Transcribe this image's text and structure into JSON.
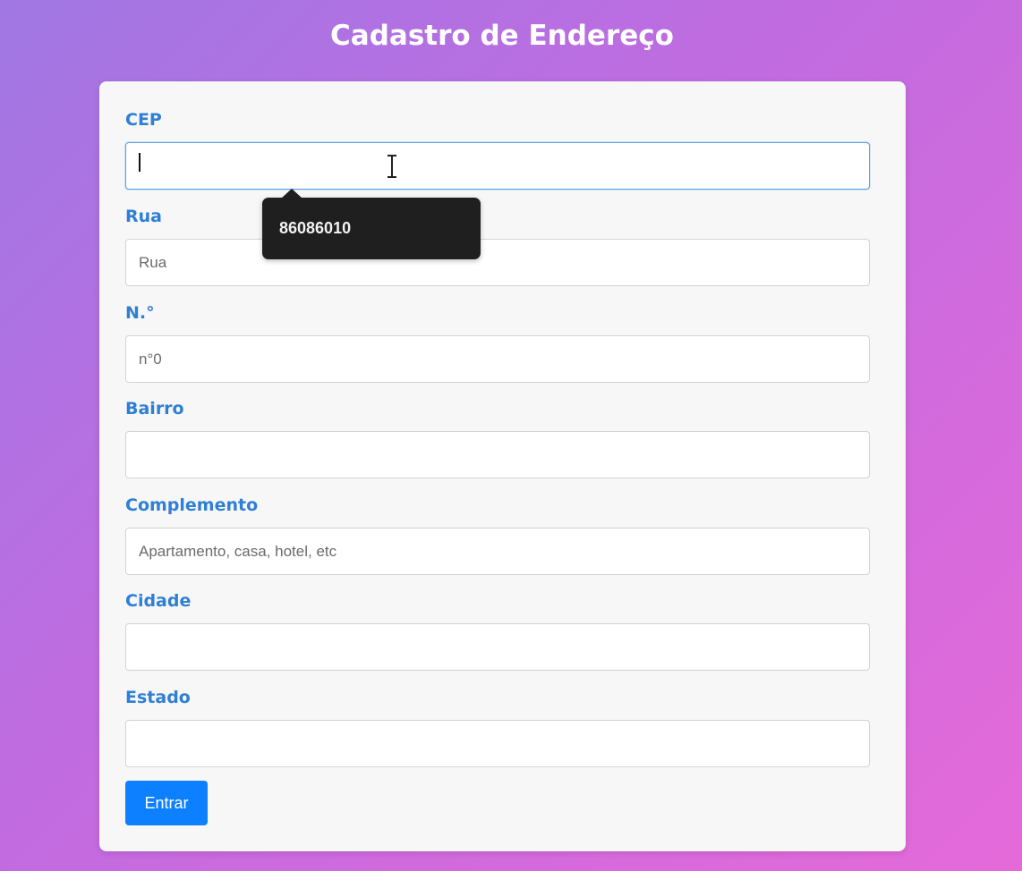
{
  "page": {
    "title": "Cadastro de Endereço"
  },
  "form": {
    "cep": {
      "label": "CEP",
      "value": "",
      "placeholder": ""
    },
    "rua": {
      "label": "Rua",
      "value": "",
      "placeholder": "Rua"
    },
    "numero": {
      "label": "N.°",
      "value": "",
      "placeholder": "n°0"
    },
    "bairro": {
      "label": "Bairro",
      "value": "",
      "placeholder": ""
    },
    "complemento": {
      "label": "Complemento",
      "value": "",
      "placeholder": "Apartamento, casa, hotel, etc"
    },
    "cidade": {
      "label": "Cidade",
      "value": "",
      "placeholder": ""
    },
    "estado": {
      "label": "Estado",
      "value": "",
      "placeholder": ""
    },
    "submit_label": "Entrar"
  },
  "autofill_suggestion": {
    "text": "86086010"
  },
  "colors": {
    "label": "#2f7fd4",
    "button": "#0d80ff",
    "card": "#f7f7f8",
    "tooltip": "#1f1f1f"
  },
  "cursor": {
    "icon": "text-cursor-icon"
  }
}
